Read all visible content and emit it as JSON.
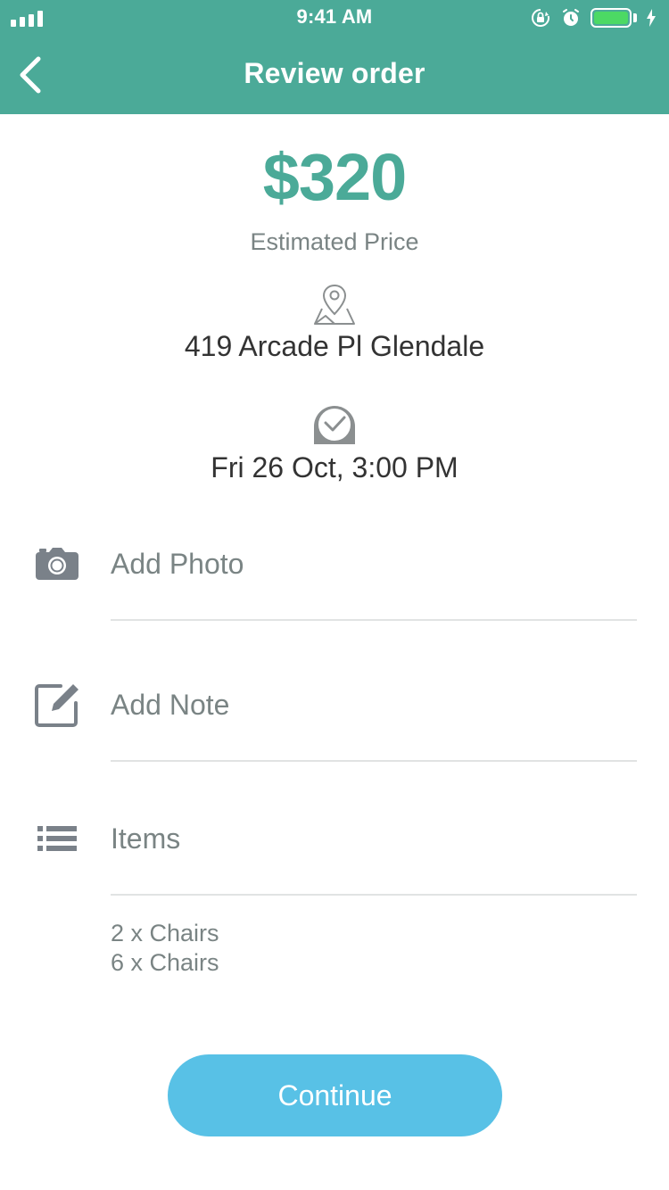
{
  "status_bar": {
    "time": "9:41 AM",
    "icons": [
      "signal-icon",
      "rotation-lock-icon",
      "alarm-icon",
      "battery-icon",
      "charging-icon"
    ],
    "battery_color": "#4cd964"
  },
  "header": {
    "title": "Review order",
    "back_icon": "back-chevron-icon",
    "background": "#4baa98"
  },
  "summary": {
    "price": "$320",
    "price_label": "Estimated Price",
    "address": "419 Arcade Pl Glendale",
    "datetime": "Fri 26 Oct, 3:00 PM",
    "location_icon": "location-pin-icon",
    "time_icon": "clock-icon",
    "accent": "#4baa98"
  },
  "actions": {
    "add_photo": "Add Photo",
    "add_note": "Add Note",
    "items": "Items"
  },
  "items": [
    "2 x Chairs",
    "6 x Chairs"
  ],
  "footer": {
    "continue_label": "Continue",
    "button_color": "#58c1e6"
  }
}
